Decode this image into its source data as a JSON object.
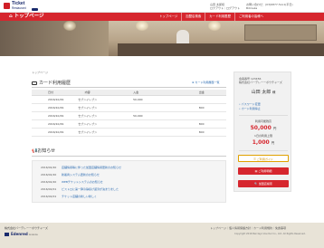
{
  "header": {
    "logo_main": "Ticket",
    "logo_sub": "Restaurant",
    "user_line1": "山田 太郎様",
    "user_line2": "ロクアウト｜ログアウト",
    "right_line1": "お問い合わせ：(03)6877-5xx1(平日)",
    "right_line2": "Bdmeka"
  },
  "nav": {
    "title": "トップページ",
    "items": [
      "トップページ",
      "加盟店検索",
      "カード利用履歴",
      "ご利用者の皆様へ"
    ]
  },
  "breadcrumb": "トップページ",
  "history": {
    "title": "カード利用履歴",
    "link": "カード利用履歴一覧",
    "headers": [
      "日付",
      "内容",
      "入金",
      "出金"
    ],
    "rows": [
      {
        "date": "2016/10/29",
        "shop": "セブンイレブン",
        "in": "50,000",
        "out": ""
      },
      {
        "date": "2016/10/29",
        "shop": "セブンイレブン",
        "in": "",
        "out": "800"
      },
      {
        "date": "2016/10/29",
        "shop": "セブンイレブン",
        "in": "50,000",
        "out": ""
      },
      {
        "date": "2016/10/29",
        "shop": "セブンイレブン",
        "in": "",
        "out": "800"
      },
      {
        "date": "2016/10/29",
        "shop": "セブンイレブン",
        "in": "",
        "out": "800"
      }
    ]
  },
  "notices": {
    "title": "お知らせ",
    "items": [
      {
        "date": "2016/02/20",
        "text": "店舗情報等に伴った加盟店舗情報更新のお知らせ"
      },
      {
        "date": "2016/02/20",
        "text": "新着商システム更新のお知らせ"
      },
      {
        "date": "2016/02/20",
        "text": "WEBチケットシステムのお知らせ"
      },
      {
        "date": "2016/02/01",
        "text": "ビストロに第一弾冷静投げ返済が決まりました"
      },
      {
        "date": "2016/02/01",
        "text": "チケット店舗の新しい新しく"
      }
    ]
  },
  "sidebar": {
    "member_no": "会員番号 123456",
    "company": "株式会社バーデレーーボウチャーズ",
    "name": "山田 太郎",
    "name_suffix": "様",
    "link1": "パスワード変更",
    "link2": "カード利用停止",
    "available_label": "利用可能残高",
    "available_amount": "50,000",
    "available_unit": "円",
    "daily_label": "1日の利用上限",
    "daily_amount": "1,000",
    "daily_unit": "円",
    "btn1": "ご利用ガイド",
    "btn2": "ご利用明細",
    "btn3": "加盟店検索"
  },
  "footer": {
    "company": "株式会社バーデレーーボウチャーズ",
    "brand": "Edenred",
    "brand_small": "Licence",
    "links": "トップページ｜個人情報保護方針｜カード利用規約｜免責事項",
    "copyright": "Copyright 2016 Barclays Voucher Co., Ltd. All Rights Reserved."
  },
  "colors": {
    "accent": "#d6262e",
    "link": "#2a6ab0",
    "footer_bg": "#e8e3d7"
  }
}
